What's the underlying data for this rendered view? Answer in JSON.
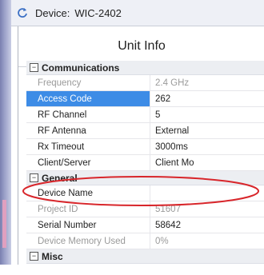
{
  "header": {
    "device_label": "Device:",
    "device_value": "WIC-2402"
  },
  "panel": {
    "title": "Unit Info"
  },
  "categories": {
    "communications": "Communications",
    "general": "General",
    "misc": "Misc"
  },
  "communications_rows": [
    {
      "name": "Frequency",
      "value": "2.4 GHz"
    },
    {
      "name": "Access Code",
      "value": "262"
    },
    {
      "name": "RF Channel",
      "value": "5"
    },
    {
      "name": "RF Antenna",
      "value": "External"
    },
    {
      "name": "Rx Timeout",
      "value": "3000ms"
    },
    {
      "name": "Client/Server",
      "value": "Client Mo"
    }
  ],
  "general_rows": [
    {
      "name": "Device Name",
      "value": ""
    },
    {
      "name": "Project ID",
      "value": "51607"
    },
    {
      "name": "Serial Number",
      "value": "58642"
    },
    {
      "name": "Device Memory Used",
      "value": "0%"
    }
  ],
  "toggle_symbol": "⊟",
  "annotation_color": "#d8262b"
}
